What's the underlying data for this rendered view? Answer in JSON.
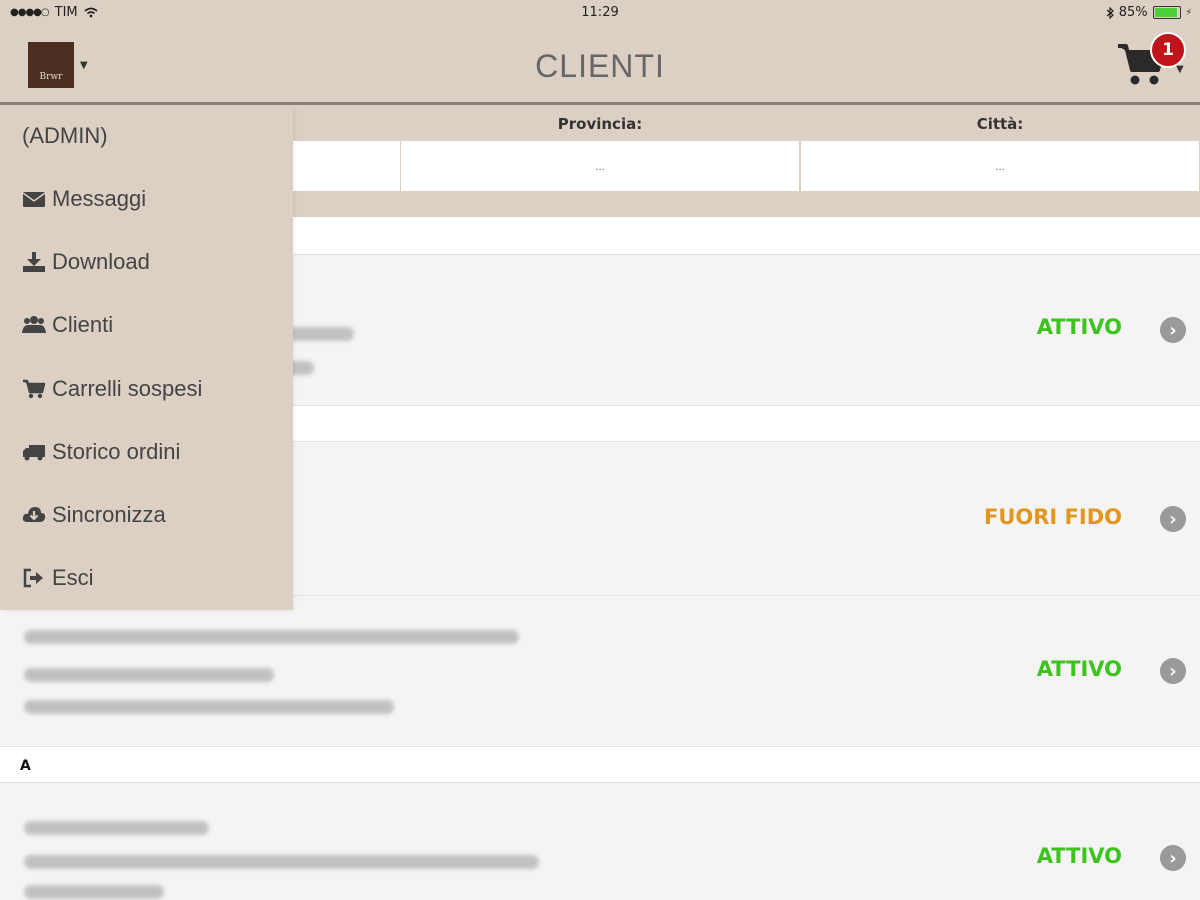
{
  "status_bar": {
    "signal_dots": "●●●●○",
    "carrier": "TIM",
    "wifi_icon": "wifi-icon",
    "time": "11:29",
    "bluetooth_icon": "bluetooth-icon",
    "battery_percent": "85%",
    "battery_level": 0.85
  },
  "header": {
    "logo_text": "Brwr",
    "title": "CLIENTI",
    "cart_badge": "1"
  },
  "filters": {
    "provincia_label": "Provincia:",
    "provincia_placeholder": "...",
    "citta_label": "Città:",
    "citta_placeholder": "..."
  },
  "side_menu": {
    "user": "(ADMIN)",
    "items": [
      {
        "label": "Messaggi",
        "icon": "envelope-icon"
      },
      {
        "label": "Download",
        "icon": "download-icon"
      },
      {
        "label": "Clienti",
        "icon": "users-icon"
      },
      {
        "label": "Carrelli sospesi",
        "icon": "cart-icon"
      },
      {
        "label": "Storico ordini",
        "icon": "truck-icon"
      },
      {
        "label": "Sincronizza",
        "icon": "cloud-download-icon"
      },
      {
        "label": "Esci",
        "icon": "sign-out-icon"
      }
    ]
  },
  "list": {
    "section_a": "A",
    "rows": [
      {
        "status": "ATTIVO",
        "status_color": "#3cc41c"
      },
      {
        "status": "FUORI FIDO",
        "status_color": "#e3961c"
      },
      {
        "status": "ATTIVO",
        "status_color": "#3cc41c"
      },
      {
        "status": "ATTIVO",
        "status_color": "#3cc41c"
      }
    ]
  },
  "colors": {
    "header_bg": "#dccfc3",
    "active": "#3cc41c",
    "over_limit": "#e3961c",
    "badge": "#c0141c"
  }
}
